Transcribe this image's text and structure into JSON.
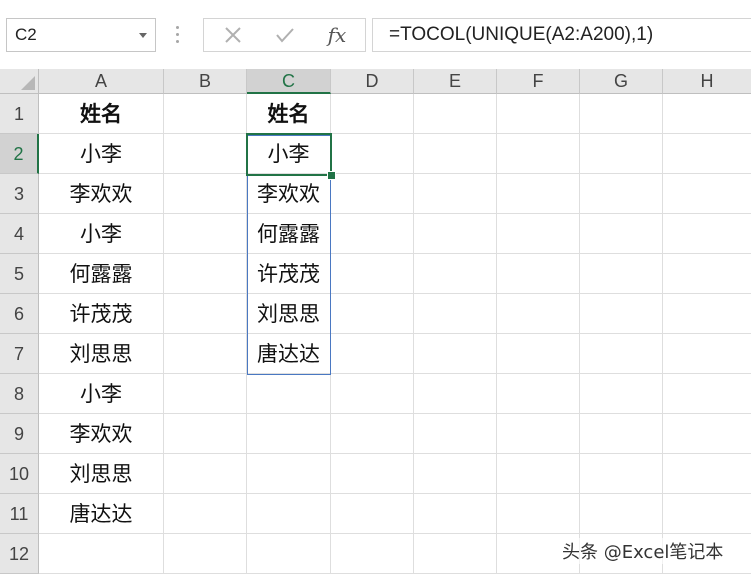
{
  "formula_bar": {
    "name_box": "C2",
    "cancel_icon": "x-icon",
    "enter_icon": "checkmark-icon",
    "function_icon": "fx-icon",
    "fx_label": "fx",
    "formula": "=TOCOL(UNIQUE(A2:A200),1)"
  },
  "sheet": {
    "columns": [
      "A",
      "B",
      "C",
      "D",
      "E",
      "F",
      "G",
      "H"
    ],
    "selected_column": "C",
    "rows": [
      "1",
      "2",
      "3",
      "4",
      "5",
      "6",
      "7",
      "8",
      "9",
      "10",
      "11",
      "12"
    ],
    "selected_row": "2",
    "column_a": [
      "姓名",
      "小李",
      "李欢欢",
      "小李",
      "何露露",
      "许茂茂",
      "刘思思",
      "小李",
      "李欢欢",
      "刘思思",
      "唐达达",
      ""
    ],
    "column_c": [
      "姓名",
      "小李",
      "李欢欢",
      "何露露",
      "许茂茂",
      "刘思思",
      "唐达达",
      "",
      "",
      "",
      "",
      ""
    ]
  },
  "watermark": "头条 @Excel笔记本",
  "colors": {
    "accent_green": "#217346",
    "spill_border_blue": "#4a78c2",
    "header_bg": "#e6e6e6"
  }
}
